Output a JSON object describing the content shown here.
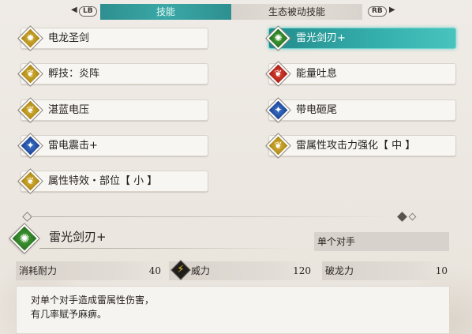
{
  "tabs": {
    "lb": "LB",
    "rb": "RB",
    "left_arrow": "◀",
    "right_arrow": "▶",
    "items": [
      {
        "label": "技能",
        "active": true
      },
      {
        "label": "生态被动技能",
        "active": false
      }
    ]
  },
  "skills_left": [
    {
      "label": "电龙圣剑",
      "icon": "sun-crest-icon",
      "color": "gold"
    },
    {
      "label": "孵技：炎阵",
      "icon": "kinship-icon",
      "color": "gold"
    },
    {
      "label": "湛蓝电压",
      "icon": "kinship-icon",
      "color": "gold"
    },
    {
      "label": "雷电震击+",
      "icon": "ally-icon",
      "color": "blue"
    },
    {
      "label": "属性特效・部位【 小 】",
      "icon": "kinship-icon",
      "color": "gold"
    }
  ],
  "skills_right": [
    {
      "label": "雷光剑刃+",
      "icon": "burst-icon",
      "color": "green",
      "selected": true
    },
    {
      "label": "能量吐息",
      "icon": "kinship-icon",
      "color": "red"
    },
    {
      "label": "带电砸尾",
      "icon": "ally-icon",
      "color": "blue"
    },
    {
      "label": "雷属性攻击力强化【 中 】",
      "icon": "kinship-icon",
      "color": "gold"
    }
  ],
  "detail": {
    "name": "雷光剑刃+",
    "icon": "burst-icon",
    "target": "单个对手",
    "stats": {
      "endurance_label": "消耗耐力",
      "endurance_value": "40",
      "power_label": "威力",
      "power_value": "120",
      "dragon_label": "破龙力",
      "dragon_value": "10"
    },
    "description_lines": [
      "对单个对手造成雷属性伤害，",
      "有几率赋予麻痹。"
    ]
  },
  "colors": {
    "accent_teal": "#36b0ad",
    "gold": "#c19a22",
    "green": "#35892c",
    "red": "#c2281c",
    "blue": "#2c5aae"
  }
}
